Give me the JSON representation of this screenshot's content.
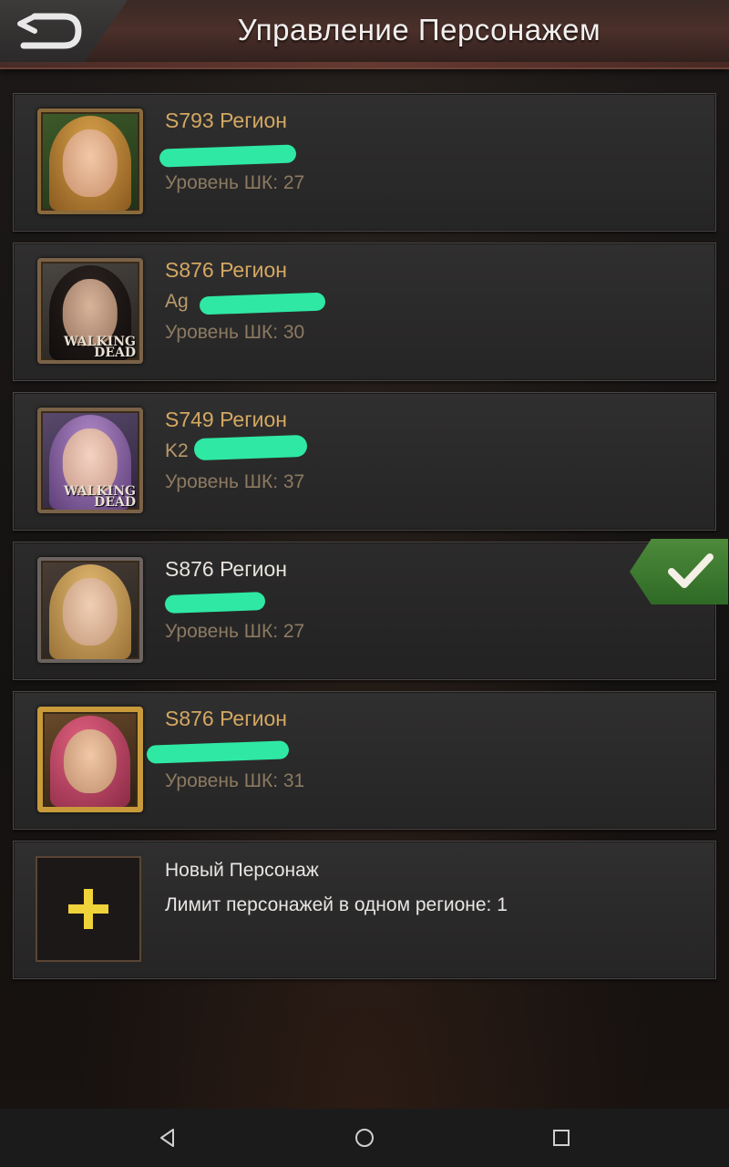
{
  "header": {
    "title": "Управление Персонажем",
    "back_icon": "back-return-arrow-icon"
  },
  "characters": [
    {
      "region": "S793 Регион",
      "name": "",
      "level": "Уровень ШК: 27",
      "selected": false
    },
    {
      "region": "S876 Регион",
      "name": "Ag",
      "level": "Уровень ШК: 30",
      "selected": false
    },
    {
      "region": "S749 Регион",
      "name": "K2",
      "level": "Уровень ШК: 37",
      "selected": false
    },
    {
      "region": "S876 Регион",
      "name": "",
      "level": "Уровень ШК: 27",
      "selected": true
    },
    {
      "region": "S876 Регион",
      "name": "",
      "level": "Уровень ШК: 31",
      "selected": false
    }
  ],
  "avatar_labels": {
    "walking_dead": "WALKING\nDEAD"
  },
  "new_character": {
    "title": "Новый Персонаж",
    "limit_text": "Лимит персонажей в одном регионе: 1",
    "icon": "plus-icon"
  },
  "navbar": {
    "back_icon": "nav-back-triangle-icon",
    "home_icon": "nav-home-circle-icon",
    "recents_icon": "nav-recents-square-icon"
  },
  "colors": {
    "region_gold": "#d4a862",
    "selected_check": "#4d8a3a",
    "redaction": "#2fe8a4"
  }
}
